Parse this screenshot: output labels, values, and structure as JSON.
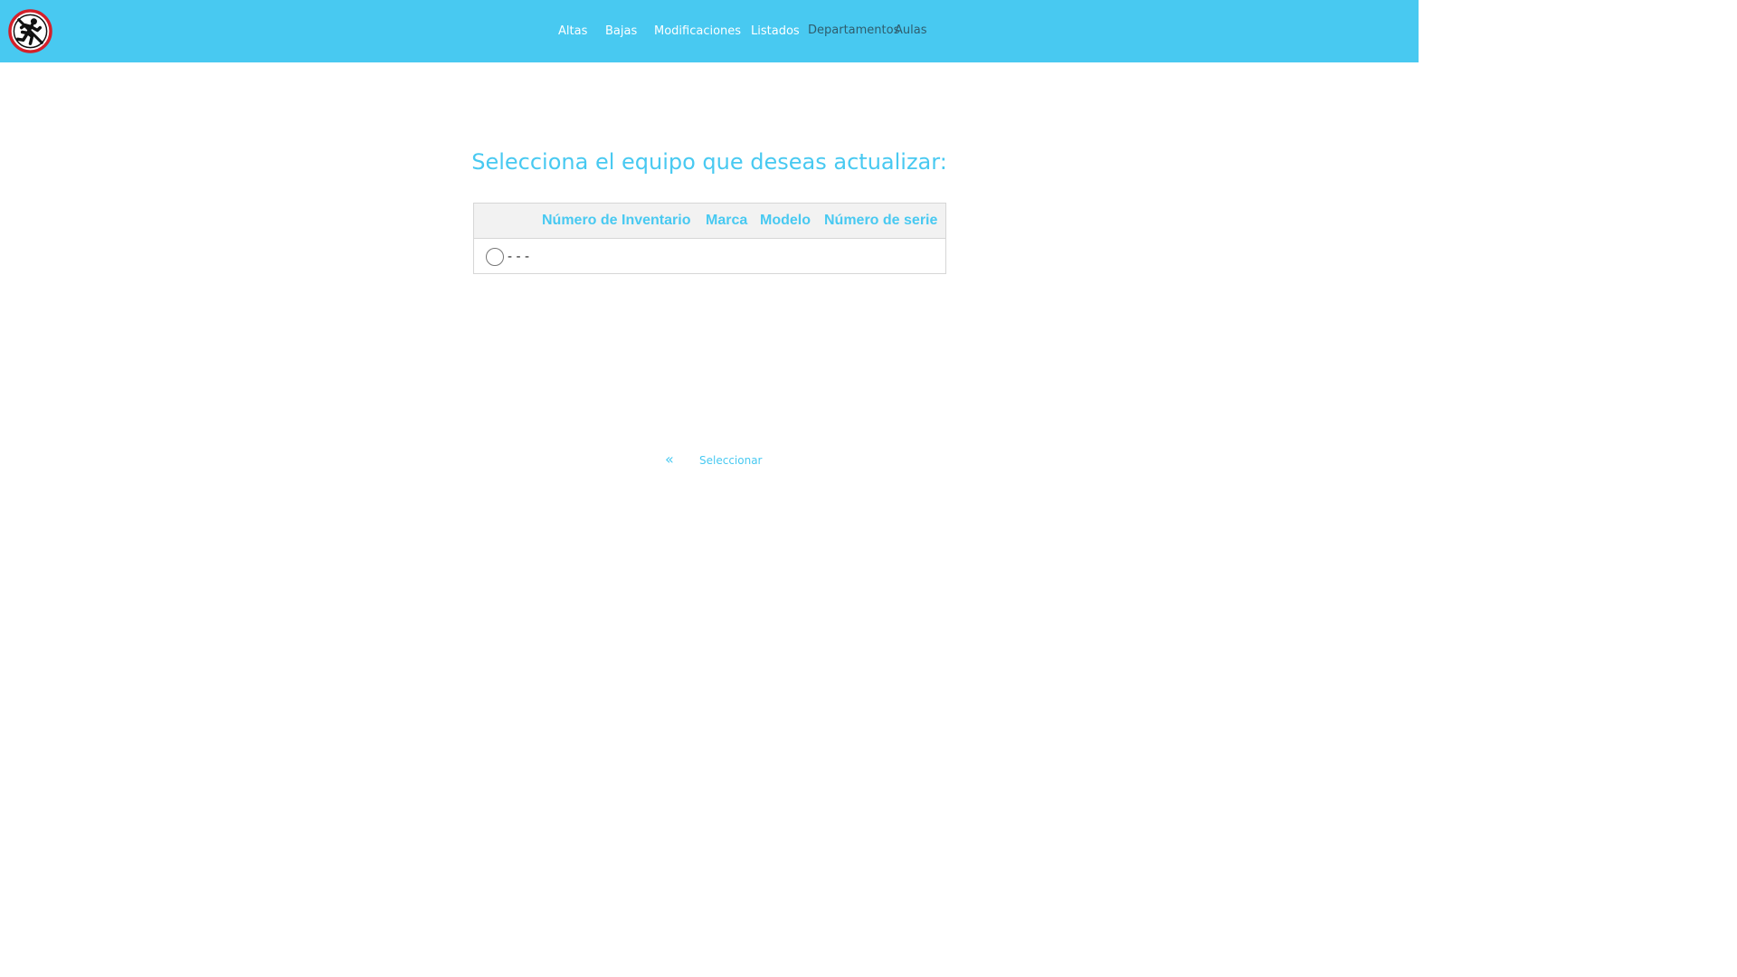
{
  "header": {
    "logo_icon": "running-person-prohibition-icon",
    "nav": [
      {
        "label": "Altas"
      },
      {
        "label": "Bajas"
      },
      {
        "label": "Modificaciones"
      },
      {
        "label": "Listados"
      },
      {
        "label": "Departamentos"
      },
      {
        "label": "Aulas"
      }
    ]
  },
  "main": {
    "title": "Selecciona el equipo que deseas actualizar:",
    "table": {
      "columns": [
        "Número de Inventario",
        "Marca",
        "Modelo",
        "Número de serie"
      ],
      "rows": [
        {
          "text": "- - -"
        }
      ]
    },
    "back_icon": "double-chevron-left-icon",
    "select_label": "Seleccionar"
  },
  "colors": {
    "accent": "#48c9f1",
    "nav_dark": "#2f5d6d",
    "table_header_bg": "#f2f2f2",
    "logo_ring": "#d3202a"
  }
}
